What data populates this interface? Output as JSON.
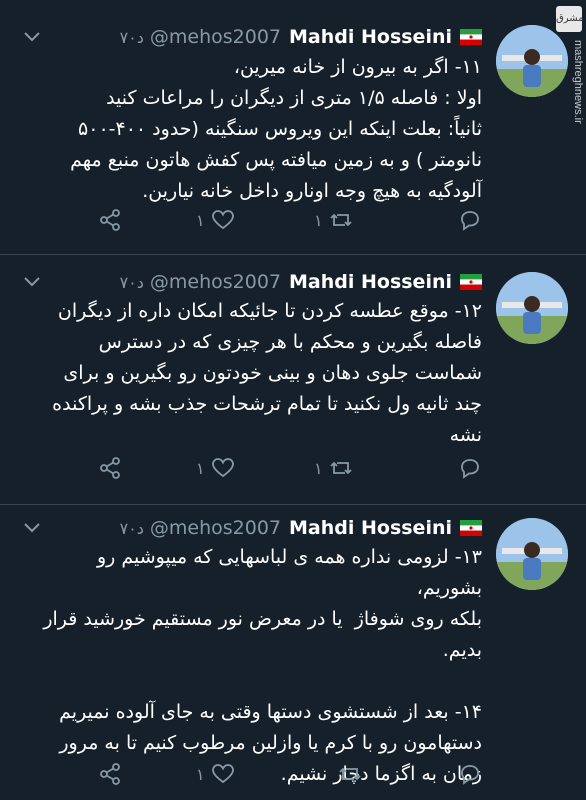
{
  "watermark": {
    "logo": "مشرق",
    "site": "mashreghnews.ir"
  },
  "colors": {
    "background": "#15202b",
    "muted": "#8899a6",
    "text": "#ffffff",
    "divider": "#38444d"
  },
  "tweets": [
    {
      "name": "Mahdi Hosseini",
      "handle": "@mehos2007",
      "time": "۷۰د",
      "text": "۱۱- اگر به بیرون از خانه میرین،\nاولا : فاصله ۱/۵ متری از دیگران را مراعات کنید\nثانیاً: بعلت اینکه این ویروس سنگینه (حدود ۴۰۰-۵۰۰\nنانومتر ) و به زمین میافته پس کفش هاتون منبع مهم\nآلودگیه به هیچ وجه اونارو داخل خانه نیارین.",
      "replies": "",
      "retweets": "۱",
      "likes": "۱"
    },
    {
      "name": "Mahdi Hosseini",
      "handle": "@mehos2007",
      "time": "۷۰د",
      "text": "۱۲- موقع عطسه کردن تا جائیکه امکان داره از دیگران\nفاصله بگیرین و محکم با هر چیزی که در دسترس\nشماست جلوی دهان و بینی خودتون رو بگیرین و برای\nچند ثانیه ول نکنید تا تمام ترشحات جذب بشه و پراکنده\nنشه",
      "replies": "",
      "retweets": "۱",
      "likes": "۱"
    },
    {
      "name": "Mahdi Hosseini",
      "handle": "@mehos2007",
      "time": "۷۰د",
      "text": "۱۳- لزومی نداره همه ی لباسهایی که میپوشیم رو بشوریم،\nبلکه روی شوفاژ  یا در معرض نور مستقیم خورشید قرار\nبدیم.\n\n۱۴- بعد از شستشوی دستها وقتی به جای آلوده نمیریم\nدستهامون رو با کرم یا وازلین مرطوب کنیم تا به مرور\nزمان به اگزما دچار نشیم.",
      "replies": "",
      "retweets": "",
      "likes": "۱"
    }
  ]
}
